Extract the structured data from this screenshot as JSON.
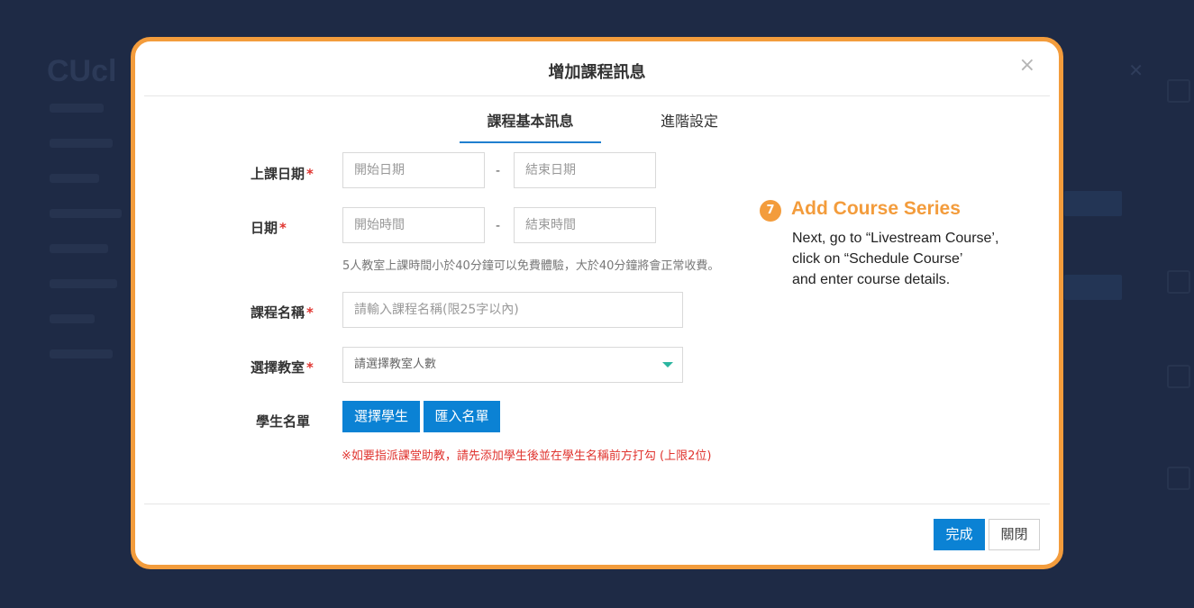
{
  "background": {
    "logo": "CUcl"
  },
  "modal": {
    "title": "增加課程訊息",
    "close_icon": "×",
    "tabs": [
      {
        "label": "課程基本訊息",
        "active": true
      },
      {
        "label": "進階設定",
        "active": false
      }
    ],
    "fields": {
      "course_date": {
        "label": "上課日期",
        "required_mark": "*",
        "start_placeholder": "開始日期",
        "end_placeholder": "結束日期",
        "separator": "-"
      },
      "time": {
        "label": "日期",
        "required_mark": "*",
        "start_placeholder": "開始時間",
        "end_placeholder": "結束時間",
        "separator": "-"
      },
      "time_hint": "5人教室上課時間小於40分鐘可以免費體驗，大於40分鐘將會正常收費。",
      "course_name": {
        "label": "課程名稱",
        "required_mark": "*",
        "placeholder": "請輸入課程名稱(限25字以內)"
      },
      "classroom": {
        "label": "選擇教室",
        "required_mark": "*",
        "placeholder": "請選擇教室人數"
      },
      "students": {
        "label": "學生名單",
        "select_button": "選擇學生",
        "import_button": "匯入名單"
      },
      "assistant_note": "※如要指派課堂助教，請先添加學生後並在學生名稱前方打勾 (上限2位)"
    },
    "footer": {
      "done_label": "完成",
      "close_label": "關閉"
    }
  },
  "annotation": {
    "step_number": "7",
    "title": "Add Course Series",
    "lines": [
      "Next, go to “Livestream Course’,",
      "click on “Schedule Course’",
      "and enter course details."
    ]
  },
  "colors": {
    "accent_orange": "#f39c3c",
    "primary_blue": "#0b82d4",
    "required_red": "#e0342f",
    "backdrop": "#1e2a45"
  }
}
